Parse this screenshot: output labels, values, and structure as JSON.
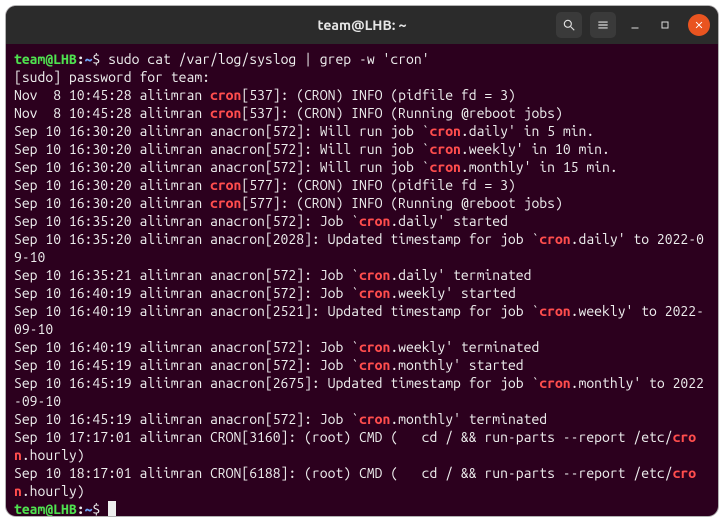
{
  "window": {
    "title": "team@LHB: ~"
  },
  "prompt": {
    "user_host": "team@LHB",
    "colon": ":",
    "path": "~",
    "dollar": "$ "
  },
  "command": {
    "pre": "sudo cat /var/log/syslog | grep -w '",
    "hl": "cron",
    "post": "'"
  },
  "lines": {
    "sudo_pw": "[sudo] password for team:",
    "l1a": "Nov  8 10:45:28 aliimran ",
    "l1b": "[537]: (CRON) INFO (pidfile fd = 3)",
    "l2a": "Nov  8 10:45:28 aliimran ",
    "l2b": "[537]: (CRON) INFO (Running @reboot jobs)",
    "l3a": "Sep 10 16:30:20 aliimran anacron[572]: Will run job `",
    "l3b": ".daily' in 5 min.",
    "l4a": "Sep 10 16:30:20 aliimran anacron[572]: Will run job `",
    "l4b": ".weekly' in 10 min.",
    "l5a": "Sep 10 16:30:20 aliimran anacron[572]: Will run job `",
    "l5b": ".monthly' in 15 min.",
    "l6a": "Sep 10 16:30:20 aliimran ",
    "l6b": "[577]: (CRON) INFO (pidfile fd = 3)",
    "l7a": "Sep 10 16:30:20 aliimran ",
    "l7b": "[577]: (CRON) INFO (Running @reboot jobs)",
    "l8a": "Sep 10 16:35:20 aliimran anacron[572]: Job `",
    "l8b": ".daily' started",
    "l9a": "Sep 10 16:35:20 aliimran anacron[2028]: Updated timestamp for job `",
    "l9b": ".daily' to 2022-09-10",
    "l10a": "Sep 10 16:35:21 aliimran anacron[572]: Job `",
    "l10b": ".daily' terminated",
    "l11a": "Sep 10 16:40:19 aliimran anacron[572]: Job `",
    "l11b": ".weekly' started",
    "l12a": "Sep 10 16:40:19 aliimran anacron[2521]: Updated timestamp for job `",
    "l12b": ".weekly' to 2022-09-10",
    "l13a": "Sep 10 16:40:19 aliimran anacron[572]: Job `",
    "l13b": ".weekly' terminated",
    "l14a": "Sep 10 16:45:19 aliimran anacron[572]: Job `",
    "l14b": ".monthly' started",
    "l15a": "Sep 10 16:45:19 aliimran anacron[2675]: Updated timestamp for job `",
    "l15b": ".monthly' to 2022-09-10",
    "l16a": "Sep 10 16:45:19 aliimran anacron[572]: Job `",
    "l16b": ".monthly' terminated",
    "l17a": "Sep 10 17:17:01 aliimran CRON[3160]: (root) CMD (   cd / && run-parts --report /etc/",
    "l17b": ".hourly)",
    "l18a": "Sep 10 18:17:01 aliimran CRON[6188]: (root) CMD (   cd / && run-parts --report /etc/",
    "l18b": ".hourly)"
  },
  "hl": "cron"
}
